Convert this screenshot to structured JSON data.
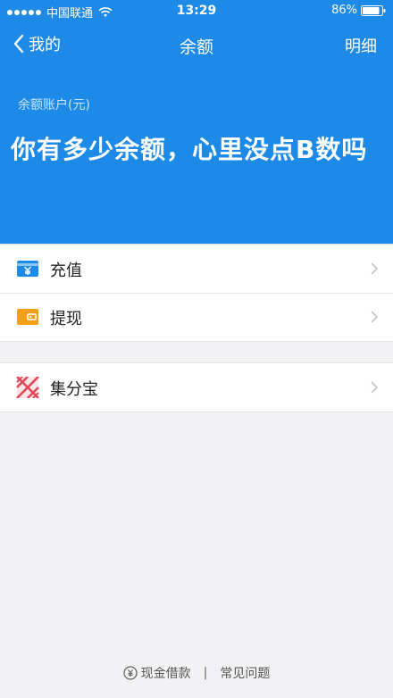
{
  "status_bar": {
    "carrier": "中国联通",
    "time": "13:29",
    "battery": "86%"
  },
  "nav": {
    "back_label": "我的",
    "title": "余额",
    "right_label": "明细"
  },
  "balance": {
    "caption": "余额账户(元)",
    "amount_text": "你有多少余额，心里没点B数吗"
  },
  "menu": {
    "recharge": {
      "label": "充值",
      "icon": "recharge-yuan-icon"
    },
    "withdraw": {
      "label": "提现",
      "icon": "wallet-icon"
    },
    "jifenbao": {
      "label": "集分宝",
      "icon": "jifenbao-icon"
    }
  },
  "footer": {
    "cash_loan": "现金借款",
    "separator": "|",
    "faq": "常见问题"
  },
  "colors": {
    "brand_blue": "#1d8ae8",
    "recharge_icon": "#1d8ae8",
    "withdraw_icon": "#f2a01a",
    "jifenbao_icon": "#e2485a"
  }
}
